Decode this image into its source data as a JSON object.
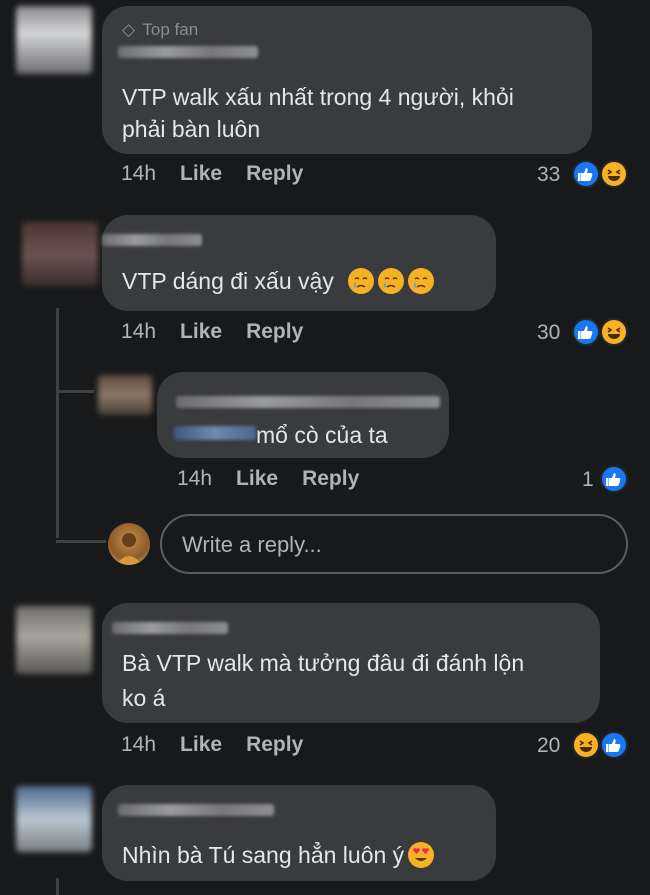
{
  "comments": [
    {
      "badge": "Top fan",
      "text_lines": [
        "VTP walk xấu nhất trong 4 người, khỏi",
        "phải bàn luôn"
      ],
      "time": "14h",
      "like": "Like",
      "reply": "Reply",
      "reaction_count": "33",
      "reactions": [
        "like-icon",
        "haha-icon"
      ]
    },
    {
      "text_lines": [
        "VTP dáng đi xấu vậy"
      ],
      "emojis": [
        "crying-emoji",
        "crying-emoji",
        "crying-emoji"
      ],
      "time": "14h",
      "like": "Like",
      "reply": "Reply",
      "reaction_count": "30",
      "reactions": [
        "like-icon",
        "haha-icon"
      ],
      "replies": [
        {
          "text": "mổ cò của ta",
          "time": "14h",
          "like": "Like",
          "reply": "Reply",
          "reaction_count": "1",
          "reactions": [
            "like-icon"
          ]
        }
      ]
    },
    {
      "text_lines": [
        "Bà VTP walk mà tưởng đâu đi đánh lộn",
        "ko á"
      ],
      "time": "14h",
      "like": "Like",
      "reply": "Reply",
      "reaction_count": "20",
      "reactions": [
        "haha-icon",
        "like-icon"
      ]
    },
    {
      "text_lines": [
        "Nhìn bà Tú sang hẳn luôn ý"
      ],
      "emojis": [
        "heart-eyes-emoji"
      ]
    }
  ],
  "reply_box": {
    "placeholder": "Write a reply..."
  },
  "colors": {
    "background": "#18191a",
    "bubble": "#3a3b3c",
    "text": "#e4e6eb",
    "secondary_text": "#b0b3b8",
    "like_blue": "#1877f2",
    "haha_yellow": "#f7b125"
  }
}
